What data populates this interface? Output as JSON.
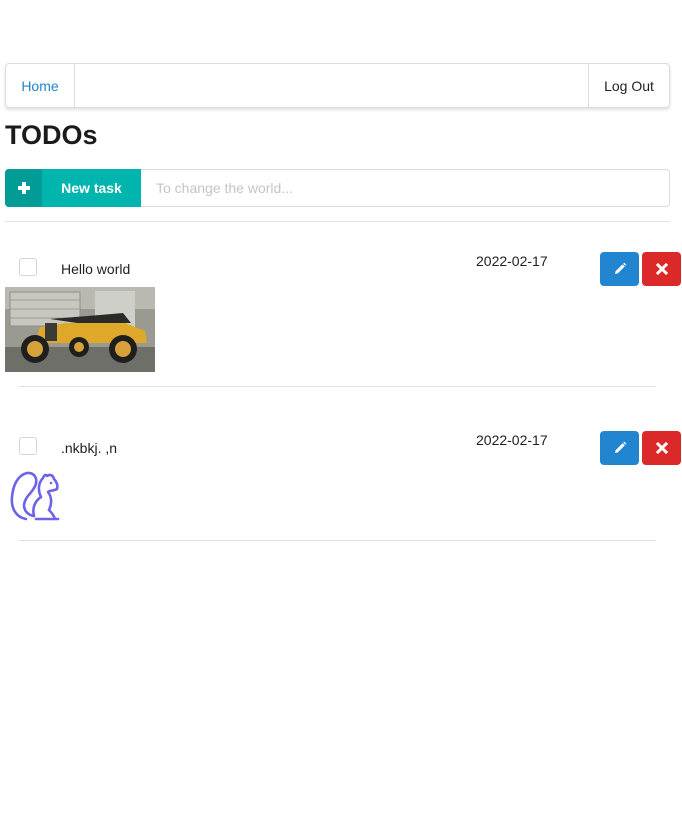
{
  "nav": {
    "home_label": "Home",
    "logout_label": "Log Out"
  },
  "page_title": "TODOs",
  "new_task": {
    "button_label": "New task",
    "icon": "plus-icon",
    "input_placeholder": "To change the world...",
    "input_value": ""
  },
  "todos": [
    {
      "text": "Hello world",
      "date": "2022-02-17",
      "checked": false,
      "attachment": "photo of a yellow vintage car",
      "edit_icon": "pencil-icon",
      "delete_icon": "close-icon"
    },
    {
      "text": ".nkbkj. ,n",
      "date": "2022-02-17",
      "checked": false,
      "attachment": "squirrel-icon",
      "edit_icon": "pencil-icon",
      "delete_icon": "close-icon"
    }
  ],
  "colors": {
    "accent_teal": "#00b5ad",
    "edit_blue": "#2185d0",
    "delete_red": "#db2828",
    "link_blue": "#2185d0",
    "squirrel_purple": "#6c63e8"
  }
}
